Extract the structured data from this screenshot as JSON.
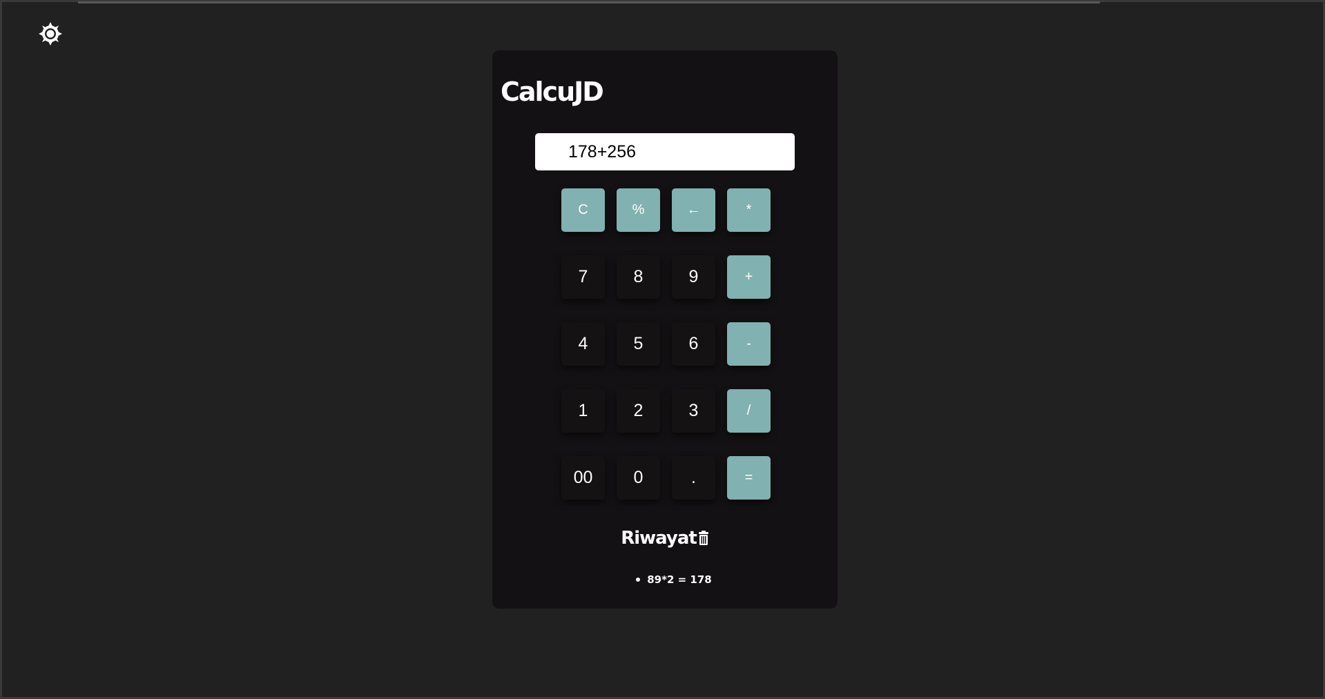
{
  "app": {
    "title": "CalcuJD"
  },
  "theme_toggle": {
    "icon": "sun-icon"
  },
  "display": {
    "value": "178+256"
  },
  "keys": [
    {
      "label": "C",
      "kind": "op",
      "name": "clear-button"
    },
    {
      "label": "%",
      "kind": "op",
      "name": "percent-button"
    },
    {
      "label": "←",
      "kind": "op",
      "name": "backspace-button"
    },
    {
      "label": "*",
      "kind": "op",
      "name": "multiply-button"
    },
    {
      "label": "7",
      "kind": "num",
      "name": "digit-7-button"
    },
    {
      "label": "8",
      "kind": "num",
      "name": "digit-8-button"
    },
    {
      "label": "9",
      "kind": "num",
      "name": "digit-9-button"
    },
    {
      "label": "+",
      "kind": "op",
      "name": "add-button"
    },
    {
      "label": "4",
      "kind": "num",
      "name": "digit-4-button"
    },
    {
      "label": "5",
      "kind": "num",
      "name": "digit-5-button"
    },
    {
      "label": "6",
      "kind": "num",
      "name": "digit-6-button"
    },
    {
      "label": "-",
      "kind": "op",
      "name": "subtract-button"
    },
    {
      "label": "1",
      "kind": "num",
      "name": "digit-1-button"
    },
    {
      "label": "2",
      "kind": "num",
      "name": "digit-2-button"
    },
    {
      "label": "3",
      "kind": "num",
      "name": "digit-3-button"
    },
    {
      "label": "/",
      "kind": "op",
      "name": "divide-button"
    },
    {
      "label": "00",
      "kind": "num",
      "name": "double-zero-button"
    },
    {
      "label": "0",
      "kind": "num",
      "name": "digit-0-button"
    },
    {
      "label": ".",
      "kind": "num",
      "name": "decimal-button"
    },
    {
      "label": "=",
      "kind": "op",
      "name": "equals-button"
    }
  ],
  "history": {
    "title": "Riwayat",
    "clear_icon": "trash-icon",
    "items": [
      "89*2 = 178"
    ]
  },
  "colors": {
    "background": "#212121",
    "card": "#131113",
    "accent": "#81b1b0",
    "number_key": "#151213",
    "text": "#ffffff"
  }
}
